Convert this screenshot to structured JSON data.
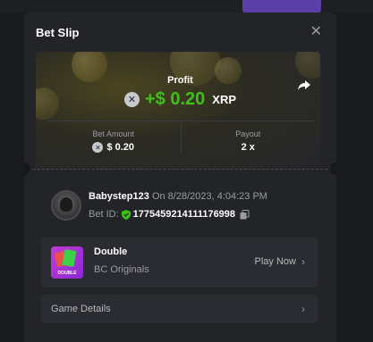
{
  "modal": {
    "title": "Bet Slip",
    "close_icon": "close-icon"
  },
  "summary": {
    "profit_label": "Profit",
    "profit_value": "+$ 0.20",
    "profit_currency": "XRP",
    "share_icon": "share-icon",
    "bet_amount_label": "Bet Amount",
    "bet_amount_value": "$ 0.20",
    "payout_label": "Payout",
    "payout_value": "2 x"
  },
  "player": {
    "name": "Babystep123",
    "timestamp": "On 8/28/2023, 4:04:23 PM",
    "bet_id_label": "Bet ID:",
    "bet_id_value": "1775459214111176998"
  },
  "game": {
    "name": "Double",
    "provider": "BC Originals",
    "play_label": "Play Now",
    "thumb_label": "DOUBLE"
  },
  "details": {
    "label": "Game Details"
  },
  "colors": {
    "accent_green": "#3bc117",
    "modal_bg": "#232428",
    "card_bg": "#2b2c31",
    "deposit_purple": "#5b3fa6"
  }
}
